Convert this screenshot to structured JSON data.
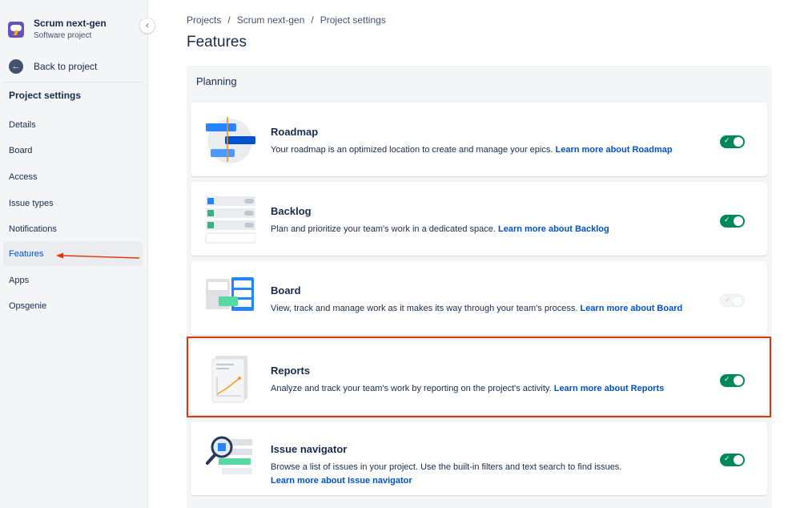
{
  "sidebar": {
    "project_name": "Scrum next-gen",
    "project_type": "Software project",
    "collapse_glyph": "‹",
    "back_label": "Back to project",
    "back_glyph": "←",
    "section_title": "Project settings",
    "items": [
      {
        "label": "Details"
      },
      {
        "label": "Board"
      },
      {
        "label": "Access"
      },
      {
        "label": "Issue types"
      },
      {
        "label": "Notifications"
      },
      {
        "label": "Features",
        "active": true
      },
      {
        "label": "Apps"
      },
      {
        "label": "Opsgenie"
      }
    ]
  },
  "breadcrumb": {
    "items": [
      "Projects",
      "Scrum next-gen",
      "Project settings"
    ],
    "separator": "/"
  },
  "page": {
    "title": "Features",
    "section_title": "Planning"
  },
  "features": [
    {
      "name": "Roadmap",
      "description": "Your roadmap is an optimized location to create and manage your epics. ",
      "link": "Learn more about Roadmap",
      "enabled": true
    },
    {
      "name": "Backlog",
      "description": "Plan and prioritize your team's work in a dedicated space. ",
      "link": "Learn more about Backlog",
      "enabled": true
    },
    {
      "name": "Board",
      "description": "View, track and manage work as it makes its way through your team's process. ",
      "link": "Learn more about Board",
      "enabled": true,
      "disabled": true
    },
    {
      "name": "Reports",
      "description": "Analyze and track your team's work by reporting on the project's activity. ",
      "link": "Learn more about Reports",
      "enabled": true
    },
    {
      "name": "Issue navigator",
      "description": "Browse a list of issues in your project. Use the built-in filters and text search to find issues.",
      "link": "Learn more about Issue navigator",
      "enabled": true
    }
  ],
  "toggle_glyph": "✓",
  "colors": {
    "accent": "#0052cc",
    "toggle_on": "#00875a",
    "highlight": "#de350b"
  }
}
